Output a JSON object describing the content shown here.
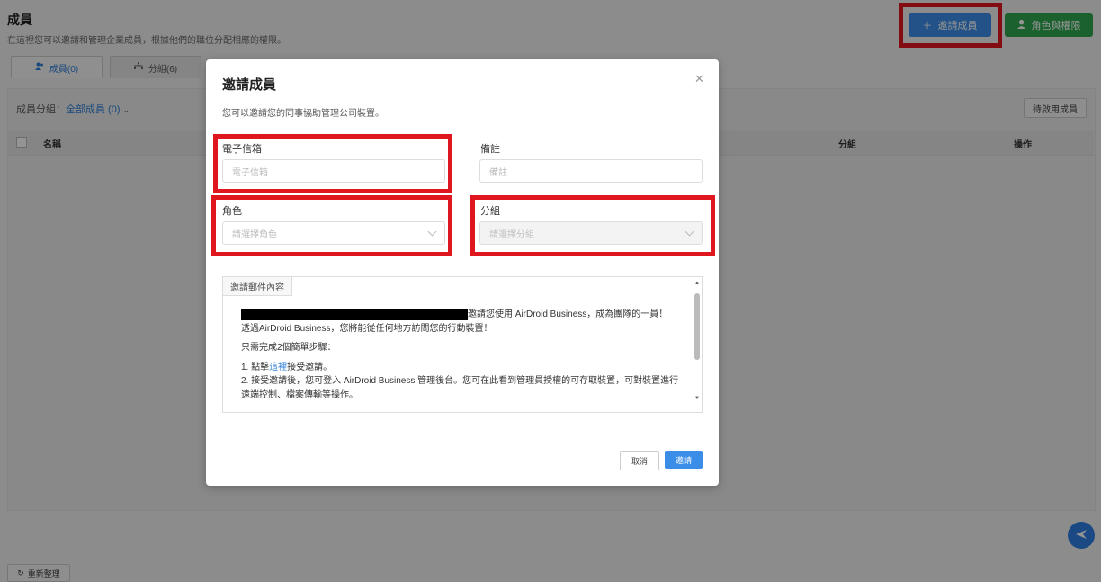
{
  "page": {
    "title": "成員",
    "subtitle": "在這裡您可以邀請和管理企業成員，根據他們的職位分配相應的權限。",
    "invite_button": "邀請成員",
    "roles_button": "角色與權限"
  },
  "tabs": [
    {
      "label": "成員(0)",
      "icon": "members-icon",
      "active": true
    },
    {
      "label": "分組(6)",
      "icon": "group-icon",
      "active": false
    }
  ],
  "member_group": {
    "label": "成員分組：",
    "value": "全部成員 (0)"
  },
  "pending_button": "待啟用成員",
  "table": {
    "columns": [
      "名稱",
      "分組",
      "操作"
    ]
  },
  "refresh_button": "重新整理",
  "modal": {
    "title": "邀請成員",
    "subtitle": "您可以邀請您的同事協助管理公司裝置。",
    "email": {
      "label": "電子信箱",
      "placeholder": "電子信箱"
    },
    "note": {
      "label": "備註",
      "placeholder": "備註"
    },
    "role": {
      "label": "角色",
      "placeholder": "請選擇角色"
    },
    "group": {
      "label": "分組",
      "placeholder": "請選擇分組"
    },
    "mail_tab": "邀請郵件內容",
    "mail": {
      "line1_suffix": "邀請您使用 AirDroid Business，成為團隊的一員！",
      "line2": "透過AirDroid Business，您將能從任何地方訪問您的行動裝置！",
      "line3": "只需完成2個簡單步驟：",
      "step1_prefix": "1. 點擊",
      "step1_link": "這裡",
      "step1_suffix": "接受邀請。",
      "step2": "2. 接受邀請後，您可登入 AirDroid Business 管理後台。您可在此看到管理員授權的可存取裝置，可對裝置進行遠端控制、檔案傳輸等操作。"
    },
    "cancel_button": "取消",
    "confirm_button": "邀請"
  },
  "colors": {
    "primary": "#3b8ee8",
    "success": "#2fa84f",
    "highlight": "#e0161f"
  }
}
